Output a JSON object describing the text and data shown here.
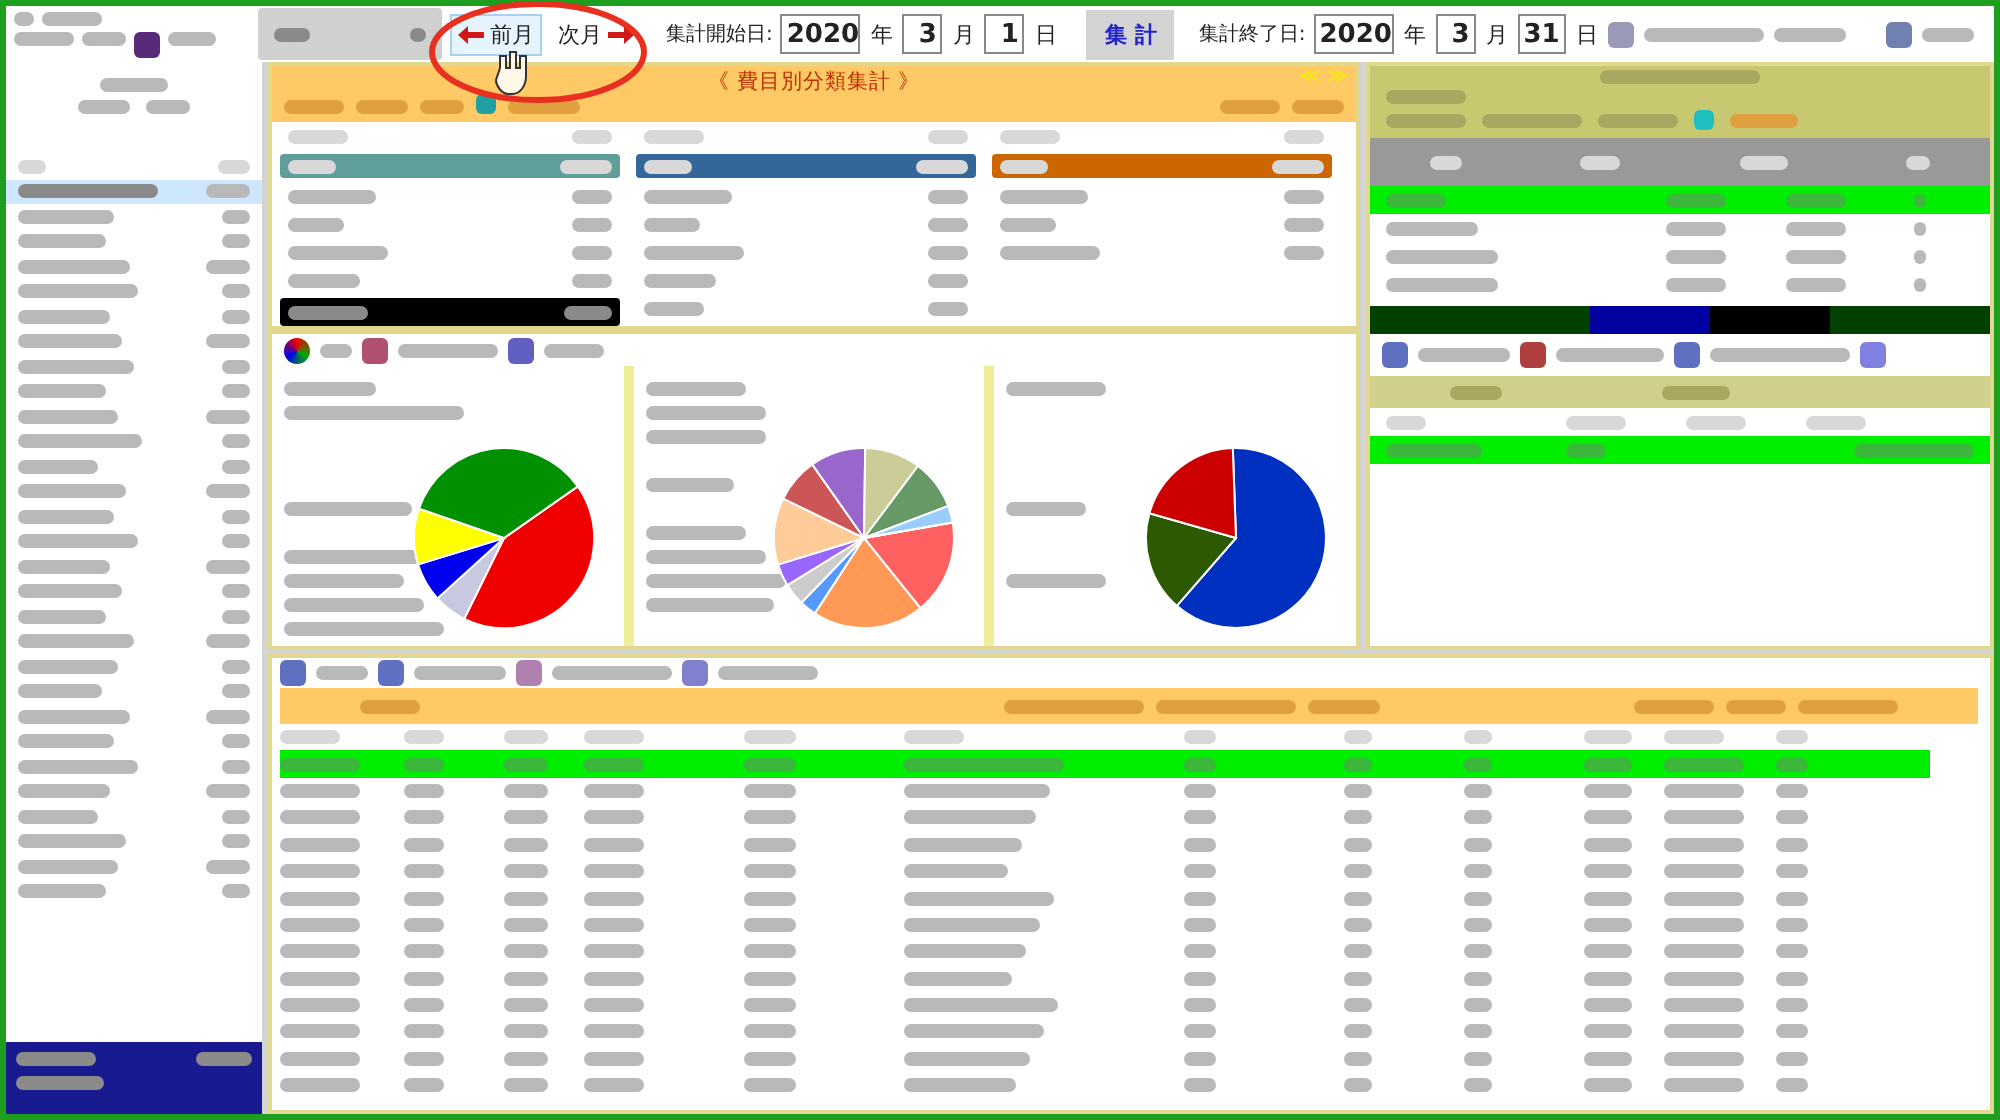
{
  "toolbar": {
    "prev_button": {
      "label": "前月"
    },
    "next_button": {
      "label": "次月"
    },
    "start_date": {
      "label": "集計開始日:",
      "year": "2020",
      "year_unit": "年",
      "month": "3",
      "month_unit": "月",
      "day": "1",
      "day_unit": "日"
    },
    "aggregate_button": {
      "label": "集 計"
    },
    "end_date": {
      "label": "集計終了日:",
      "year": "2020",
      "year_unit": "年",
      "month": "3",
      "month_unit": "月",
      "day": "31",
      "day_unit": "日"
    }
  },
  "category_panel": {
    "title": "《 費目別分類集計 》",
    "toggle": "≪ ≫"
  }
}
